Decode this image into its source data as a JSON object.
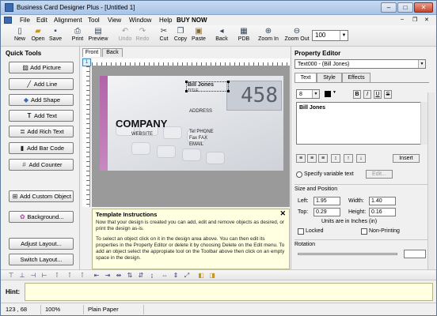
{
  "window": {
    "title": "Business Card Designer Plus - [Untitled 1]",
    "controls": [
      "–",
      "□",
      "✕"
    ]
  },
  "menu": [
    "File",
    "Edit",
    "Alignment",
    "Tool",
    "View",
    "Window",
    "Help",
    "BUY NOW"
  ],
  "toolbar": {
    "new": "New",
    "open": "Open",
    "save": "Save",
    "print": "Print",
    "preview": "Preview",
    "undo": "Undo",
    "redo": "Redo",
    "cut": "Cut",
    "copy": "Copy",
    "paste": "Paste",
    "back": "Back",
    "pdb": "PDB",
    "zoom_in": "Zoom In",
    "zoom_out": "Zoom Out",
    "zoom_value": "100"
  },
  "quick_tools": {
    "title": "Quick Tools",
    "buttons": [
      "Add Picture",
      "Add Line",
      "Add Shape",
      "Add Text",
      "Add Rich Text",
      "Add Bar Code",
      "Add Counter",
      "Add Custom Object",
      "Background...",
      "Adjust Layout...",
      "Switch Layout..."
    ]
  },
  "design": {
    "tabs": [
      "Front",
      "Back"
    ],
    "ruler_corner": "1",
    "card": {
      "name": "Bill Jones",
      "title": "TITLE",
      "address": "ADDRESS",
      "company": "COMPANY",
      "website": "WEBSITE",
      "tel": "Tel  PHONE",
      "fax": "Fax  FAX",
      "email": "EMAIL",
      "display": "458"
    }
  },
  "instructions": {
    "title": "Template Instructions",
    "close": "✕",
    "p1": "Now that your design is created you can add, edit and remove objects as desired, or print the design as-is.",
    "p2": "To select an object click on it in the design area above. You can then edit its properties in the Property Editor or delete it by choosing Delete on the Edit menu. To add an object select the appropiate tool on the Toolbar above then click on an empty space in the design."
  },
  "property_editor": {
    "title": "Property Editor",
    "object": "Text000 - (Bill Jones)",
    "tabs": [
      "Text",
      "Style",
      "Effects"
    ],
    "font_size": "8",
    "format_buttons": [
      "B",
      "I",
      "U",
      "S"
    ],
    "text_value": "Bill Jones",
    "insert": "Insert",
    "specify_variable": "Specify variable text",
    "edit": "Edit...",
    "size_position": "Size and Position",
    "left_label": "Left:",
    "left": "1.95",
    "width_label": "Width:",
    "width": "1.40",
    "top_label": "Top:",
    "top": "0.29",
    "height_label": "Height:",
    "height": "0.16",
    "units": "Units are in Inches (in)",
    "locked": "Locked",
    "non_printing": "Non-Printing",
    "rotation": "Rotation"
  },
  "hint": {
    "label": "Hint:"
  },
  "status": {
    "coords": "123 , 68",
    "zoom": "100%",
    "paper": "Plain Paper"
  }
}
